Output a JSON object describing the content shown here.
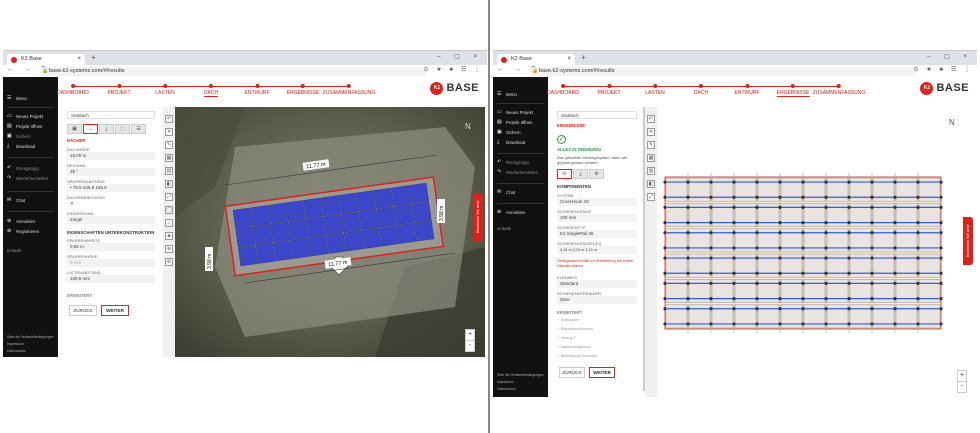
{
  "browser": {
    "tab_title": "K2 Base",
    "tab_close": "×",
    "new_tab": "+",
    "window_controls": "– ▢ ×",
    "nav_buttons": "← → C",
    "lock": "🔒",
    "url": "base.k2-systems.com/#/results",
    "extensions": "⊙ ★ ♣ ☰ ⋮"
  },
  "sidebar": {
    "menu": "Menü",
    "items": [
      {
        "label": "Neues Projekt",
        "icon": "new-project-icon",
        "glyph": "▭"
      },
      {
        "label": "Projekt öffnen",
        "icon": "open-folder-icon",
        "glyph": "▤"
      },
      {
        "label": "Sichern",
        "icon": "save-icon",
        "glyph": "▣"
      },
      {
        "label": "Download",
        "icon": "download-icon",
        "glyph": "⤓"
      }
    ],
    "items2": [
      {
        "label": "Rückgängig",
        "icon": "undo-icon",
        "glyph": "↶"
      },
      {
        "label": "Wiederherstellen",
        "icon": "redo-icon",
        "glyph": "↷"
      }
    ],
    "chat": {
      "label": "Chat",
      "icon": "chat-icon",
      "glyph": "✉"
    },
    "login": {
      "label": "Anmelden",
      "icon": "login-icon",
      "glyph": "⊕"
    },
    "register": {
      "label": "Registrieren",
      "icon": "register-icon",
      "glyph": "⊕"
    },
    "footer": [
      "Über die Verkaufsbedingungen",
      "Impressum",
      "Datenschutz"
    ],
    "version": "K2 BASE"
  },
  "progress": {
    "steps": [
      "DASHBOARD",
      "PROJEKT",
      "LASTEN",
      "DACH",
      "ENTWURF",
      "ERGEBNISSE",
      "ZUSAMMENFASSUNG"
    ],
    "active_left": "DACH",
    "active_right": "ERGEBNISSE"
  },
  "brand": {
    "logo_mark": "K2",
    "logo_text": "BASE",
    "color": "#d9231c"
  },
  "left_form": {
    "roof_select": "Süddach",
    "section_dach": "DÄCHER",
    "fields": [
      {
        "label": "DACHHÖHE",
        "value": "18,00 m"
      },
      {
        "label": "NEIGUNG",
        "value": "35 °"
      },
      {
        "label": "SPARRENABSTAND",
        "value": "•      78,5      346,8      106,9"
      },
      {
        "label": "DACHEINDECKUNG",
        "value": "✕"
      },
      {
        "label": "EINDECKUNG",
        "value": "Ziegel"
      }
    ],
    "section_sub": "EIGENSCHAFTEN UNTERKONSTRUKTION",
    "fields2": [
      {
        "label": "SPARRENBREITE",
        "value": "0,65 m"
      },
      {
        "label": "SPARRENHÖHE",
        "value": "0 mm"
      },
      {
        "label": "LATTENABSTAND",
        "value": "340,5 mm"
      }
    ],
    "advanced": "ERWEITERT",
    "back": "ZURÜCK",
    "next": "WEITER"
  },
  "map_tools": [
    "↶",
    "✕",
    "✎",
    "▦",
    "▥",
    "◧",
    "⤢",
    "◯",
    "⌂",
    "◈",
    "⊕",
    "⚙"
  ],
  "dimensions": {
    "top": "11,77 m",
    "bottom": "11,77 m",
    "left": "3,58 m",
    "right": "3,58 m"
  },
  "feedback_label": "Bewerten Sie uns!",
  "zoom": {
    "plus": "+",
    "minus": "-"
  },
  "compass": "N",
  "right_form": {
    "roof_select": "Süddach",
    "section_results": "ERGEBNISSE",
    "ok_icon": "✓",
    "ok_text": "ALLES IN ORDNUNG!",
    "ok_desc": "Das gewählte Montagesystem kann wie geplant gebaut werden.",
    "section_components": "KOMPONENTEN",
    "fields": [
      {
        "label": "SYSTEM",
        "value": "CrossHook 3S"
      },
      {
        "label": "SCHIENENLÄNGE",
        "value": "100 mm"
      },
      {
        "label": "SCHIENENTYP",
        "value": "K2 SingleRail 36"
      },
      {
        "label": "SCHIENENLÄNGEN [m]",
        "value": "3,15 m    3,15 m    3,15 m"
      }
    ],
    "warning": "Verfügbarkeit bitte vor Bestellung bei Ihrem Händler klären",
    "fields2": [
      {
        "label": "KLEMMEN",
        "value": "Standard"
      },
      {
        "label": "SCHIENENVERBINDER",
        "value": "Zwei"
      }
    ],
    "section_extended": "ERWEITERT",
    "checks": [
      "Endkappen",
      "Blitzschutzklemmen",
      "Verzug Z",
      "Kabelmanagement",
      "Befestigung Tarnmatte"
    ],
    "back": "ZURÜCK",
    "next": "WEITER"
  }
}
